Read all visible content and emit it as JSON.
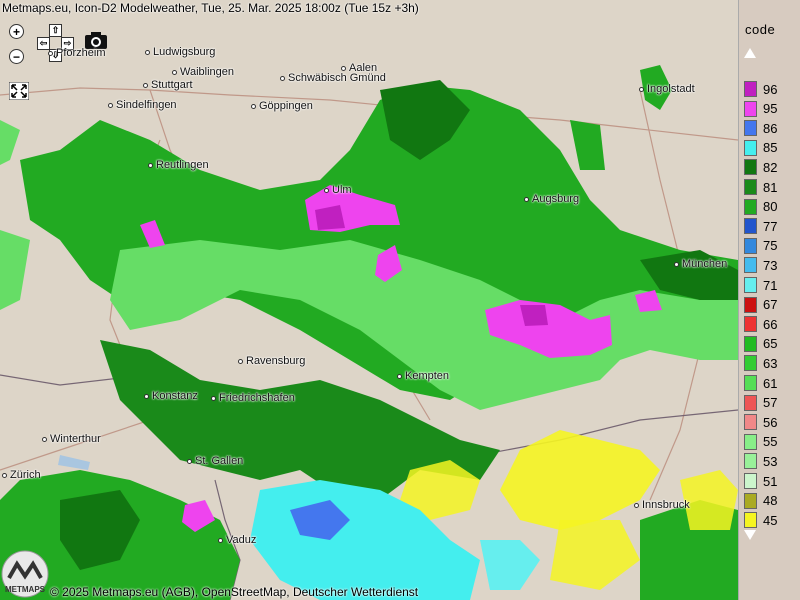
{
  "header": {
    "title": "Metmaps.eu, Icon-D2 Modelweather, Tue, 25. Mar. 2025 18:00z (Tue 15z +3h)"
  },
  "controls": {
    "zoom_in": "+",
    "zoom_out": "−",
    "pan_up": "⇧",
    "pan_down": "⇩",
    "pan_left": "⇦",
    "pan_right": "⇨",
    "camera_icon": "camera-icon",
    "fullscreen_icon": "fullscreen-icon"
  },
  "cities": [
    {
      "name": "Pforzheim"
    },
    {
      "name": "Ludwigsburg"
    },
    {
      "name": "Waiblingen"
    },
    {
      "name": "Stuttgart"
    },
    {
      "name": "Sindelfingen"
    },
    {
      "name": "Göppingen"
    },
    {
      "name": "Schwäbisch Gmünd"
    },
    {
      "name": "Aalen"
    },
    {
      "name": "Ingolstadt"
    },
    {
      "name": "Reutlingen"
    },
    {
      "name": "Ulm"
    },
    {
      "name": "Augsburg"
    },
    {
      "name": "München"
    },
    {
      "name": "Ravensburg"
    },
    {
      "name": "Kempten"
    },
    {
      "name": "Konstanz"
    },
    {
      "name": "Friedrichshafen"
    },
    {
      "name": "Winterthur"
    },
    {
      "name": "St. Gallen"
    },
    {
      "name": "Zürich"
    },
    {
      "name": "Innsbruck"
    },
    {
      "name": "Vaduz"
    }
  ],
  "footer": {
    "copyright": "© 2025 Metmaps.eu (AGB), OpenStreetMap, Deutscher Wetterdienst",
    "logo_text": "METMAPS"
  },
  "legend": {
    "title": "code",
    "items": [
      {
        "value": "96",
        "color": "#c020c0"
      },
      {
        "value": "95",
        "color": "#ee44ee"
      },
      {
        "value": "86",
        "color": "#4477ee"
      },
      {
        "value": "85",
        "color": "#44eeee"
      },
      {
        "value": "82",
        "color": "#117711"
      },
      {
        "value": "81",
        "color": "#1a8a1a"
      },
      {
        "value": "80",
        "color": "#22aa22"
      },
      {
        "value": "77",
        "color": "#2255cc"
      },
      {
        "value": "75",
        "color": "#3388dd"
      },
      {
        "value": "73",
        "color": "#44bbee"
      },
      {
        "value": "71",
        "color": "#66eeee"
      },
      {
        "value": "67",
        "color": "#cc1111"
      },
      {
        "value": "66",
        "color": "#ee3333"
      },
      {
        "value": "65",
        "color": "#22bb22"
      },
      {
        "value": "63",
        "color": "#33cc33"
      },
      {
        "value": "61",
        "color": "#55dd55"
      },
      {
        "value": "57",
        "color": "#ee5555"
      },
      {
        "value": "56",
        "color": "#f08888"
      },
      {
        "value": "55",
        "color": "#88ee88"
      },
      {
        "value": "53",
        "color": "#99f099"
      },
      {
        "value": "51",
        "color": "#ccf5cc"
      },
      {
        "value": "48",
        "color": "#aaaa22"
      },
      {
        "value": "45",
        "color": "#f5f522"
      }
    ]
  }
}
